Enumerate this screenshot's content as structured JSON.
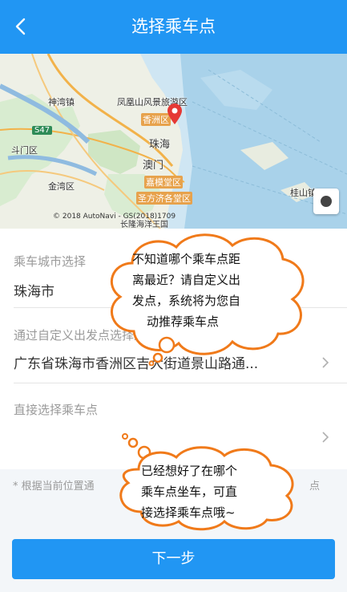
{
  "header": {
    "title": "选择乘车点"
  },
  "map": {
    "labels": {
      "shenmo": "神湾镇",
      "fenghuang": "凤凰山风景旅游区",
      "xiangzhou": "香洲区",
      "zhuhai": "珠海",
      "aomen": "澳门",
      "doumen": "斗门区",
      "jinwan": "金湾区",
      "hengqin": "嘉模堂区",
      "shengfang": "圣方济各堂区",
      "guishan": "桂山镇",
      "road": "S47",
      "changlong": "长隆海洋王国"
    },
    "copyright": "© 2018 AutoNavi - GS(2018)1709"
  },
  "form": {
    "city_label": "乘车城市选择",
    "city_value": "珠海市",
    "custom_label": "通过自定义出发点选择乘车点",
    "custom_value": "广东省珠海市香洲区吉大街道景山路通...",
    "direct_label": "直接选择乘车点",
    "direct_value": ""
  },
  "hint": {
    "text": "* 根据当前位置通",
    "tail": "点"
  },
  "next_button": "下一步",
  "bubbles": {
    "top": [
      "不知道哪个乘车点距",
      "离最近？请自定义出",
      "发点，系统将为您自",
      "动推荐乘车点"
    ],
    "bottom": [
      "已经想好了在哪个",
      "乘车点坐车，可直",
      "接选择乘车点哦~"
    ]
  },
  "colors": {
    "primary": "#2196f3",
    "bubble_stroke": "#f07a1a"
  }
}
